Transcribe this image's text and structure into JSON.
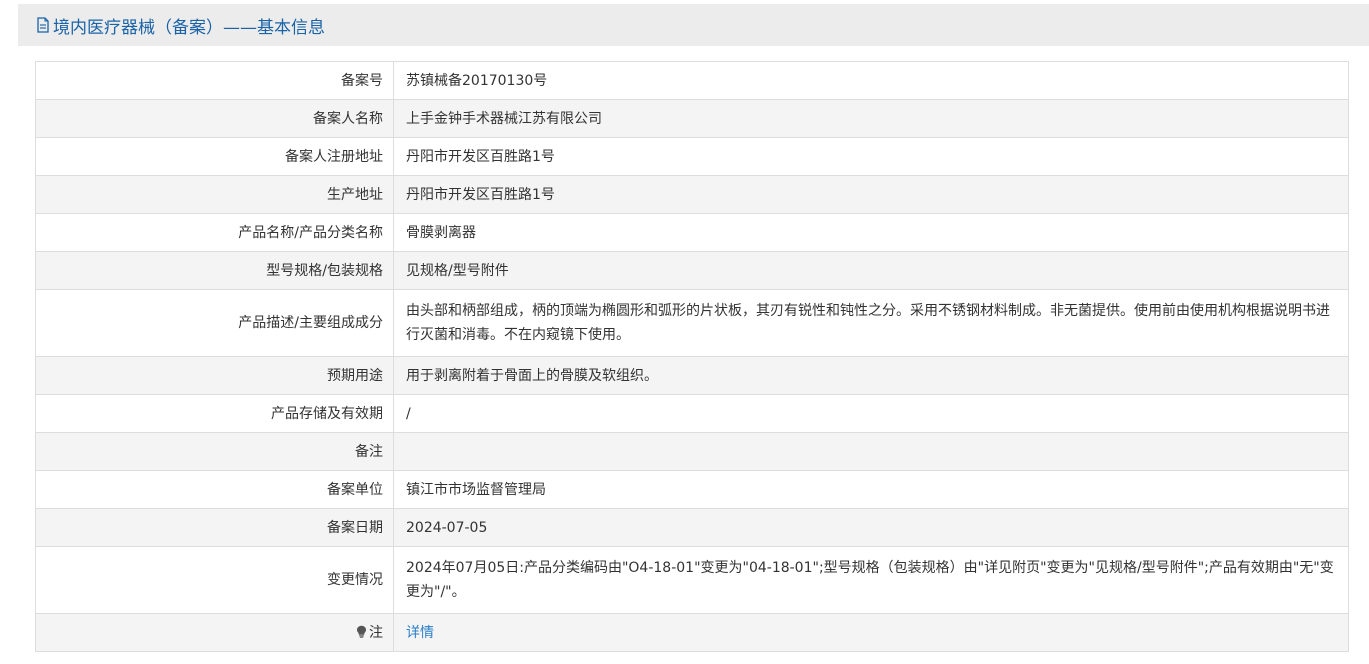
{
  "header": {
    "icon": "document-icon",
    "title": "境内医疗器械（备案）——基本信息"
  },
  "rows": [
    {
      "key": "record_no",
      "label": "备案号",
      "value": "苏镇械备20170130号"
    },
    {
      "key": "filer_name",
      "label": "备案人名称",
      "value": "上手金钟手术器械江苏有限公司"
    },
    {
      "key": "filer_address",
      "label": "备案人注册地址",
      "value": "丹阳市开发区百胜路1号"
    },
    {
      "key": "production_address",
      "label": "生产地址",
      "value": "丹阳市开发区百胜路1号"
    },
    {
      "key": "product_name",
      "label": "产品名称/产品分类名称",
      "value": "骨膜剥离器"
    },
    {
      "key": "model_spec",
      "label": "型号规格/包装规格",
      "value": "见规格/型号附件"
    },
    {
      "key": "description",
      "label": "产品描述/主要组成成分",
      "value": "由头部和柄部组成，柄的顶端为椭圆形和弧形的片状板，其刃有锐性和钝性之分。采用不锈钢材料制成。非无菌提供。使用前由使用机构根据说明书进行灭菌和消毒。不在内窥镜下使用。"
    },
    {
      "key": "intended_use",
      "label": "预期用途",
      "value": "用于剥离附着于骨面上的骨膜及软组织。"
    },
    {
      "key": "storage",
      "label": "产品存储及有效期",
      "value": "/"
    },
    {
      "key": "remarks",
      "label": "备注",
      "value": ""
    },
    {
      "key": "record_unit",
      "label": "备案单位",
      "value": "镇江市市场监督管理局"
    },
    {
      "key": "record_date",
      "label": "备案日期",
      "value": "2024-07-05"
    },
    {
      "key": "changes",
      "label": "变更情况",
      "value": "2024年07月05日:产品分类编码由\"O4-18-01\"变更为\"04-18-01\";型号规格（包装规格）由\"详见附页\"变更为\"见规格/型号附件\";产品有效期由\"无\"变更为\"/\"。"
    },
    {
      "key": "note",
      "label": "注",
      "value": "详情",
      "icon": "lightbulb-icon"
    }
  ],
  "colors": {
    "header_bg": "#ececec",
    "title_color": "#1a63a8",
    "link_color": "#2a7fc9",
    "border": "#dddddd",
    "stripe": "#f4f4f4"
  }
}
